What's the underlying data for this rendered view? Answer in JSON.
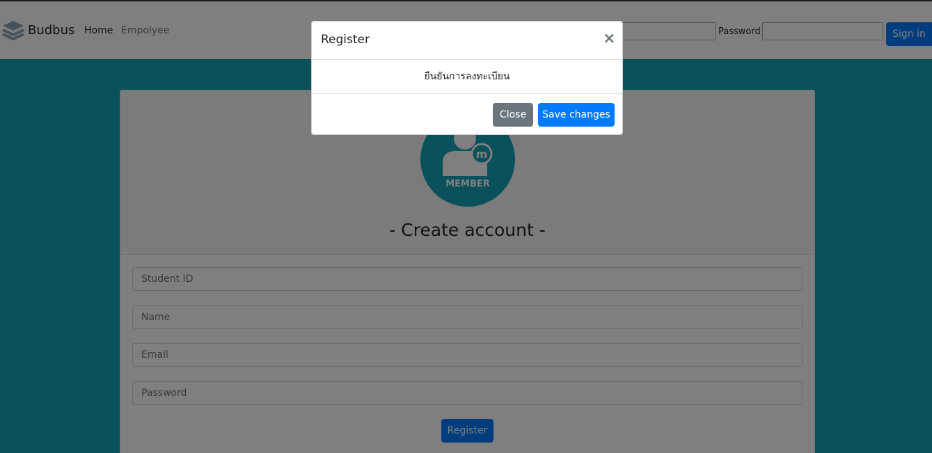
{
  "navbar": {
    "brand": "Budbus",
    "links": [
      "Home",
      "Empolyee"
    ],
    "password_label": "Password",
    "signin_label": "Sign in"
  },
  "card": {
    "badge_text": "MEMBER",
    "title": "- Create account -",
    "fields": {
      "student_id": "Student ID",
      "name": "Name",
      "email": "Email",
      "password": "Password"
    },
    "register_label": "Register"
  },
  "modal": {
    "title": "Register",
    "close_glyph": "×",
    "body": "ยืนยันการลงทะเบียน",
    "close_label": "Close",
    "save_label": "Save changes"
  },
  "colors": {
    "page_bg": "#17a2b8",
    "primary": "#007bff",
    "secondary": "#6c757d"
  },
  "icons": [
    "layers-icon",
    "member-icon",
    "close-icon"
  ]
}
